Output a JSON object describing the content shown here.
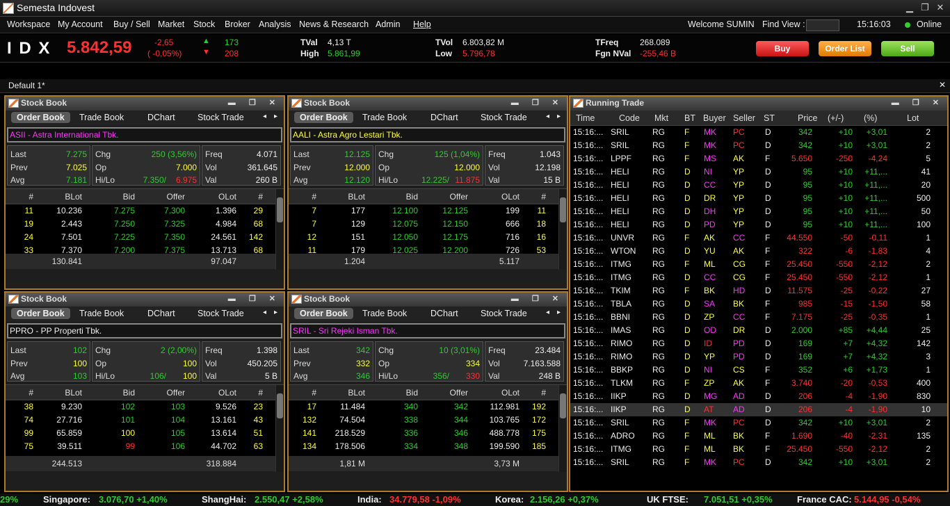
{
  "app": {
    "title": "Semesta Indovest"
  },
  "menu": {
    "items": [
      "Workspace",
      "My Account",
      "Buy / Sell",
      "Market",
      "Stock",
      "Broker",
      "Analysis",
      "News & Research",
      "Admin",
      "Help"
    ],
    "welcome": "Welcome SUMIN",
    "find_label": "Find View :",
    "time": "15:16:03",
    "status": "Online"
  },
  "index": {
    "name": "I D X",
    "value": "5.842,59",
    "chg": "-2,65",
    "chg_pct": "( -0,05%)",
    "up": "173",
    "down": "208",
    "tval_label": "TVal",
    "tval": "4,13 T",
    "high_label": "High",
    "high": "5.861,99",
    "tvol_label": "TVol",
    "tvol": "6.803,82 M",
    "low_label": "Low",
    "low": "5.796,78",
    "tfreq_label": "TFreq",
    "tfreq": "268.089",
    "fgn_label": "Fgn NVal",
    "fgn": "-255,46 B"
  },
  "buttons": {
    "buy": "Buy",
    "orderlist": "Order List",
    "sell": "Sell"
  },
  "workspace_tab": "Default 1*",
  "panels": [
    {
      "title": "Stock Book",
      "tabs": [
        "Order Book",
        "Trade Book",
        "DChart",
        "Stock Trade"
      ],
      "stock": "ASII - Astra International Tbk.",
      "stock_color": "m",
      "last": "7.275",
      "prev": "7.025",
      "avg": "7.181",
      "chg": "250 (3,56%)",
      "op": "7.000",
      "hi": "7.350/",
      "lo": "6.975",
      "freq": "4.071",
      "vol": "361.645",
      "val": "260 B",
      "rows": [
        [
          "11",
          "10.236",
          "7.275",
          "7.300",
          "1.396",
          "29"
        ],
        [
          "19",
          "2.443",
          "7.250",
          "7.325",
          "4.984",
          "68"
        ],
        [
          "24",
          "7.501",
          "7.225",
          "7.350",
          "24.561",
          "142"
        ],
        [
          "33",
          "7.370",
          "7.200",
          "7.375",
          "13.713",
          "68"
        ]
      ],
      "cols": [
        "#",
        "BLot",
        "Bid",
        "Offer",
        "OLot",
        "#"
      ],
      "foot_bid": "130.841",
      "foot_offer": "97.047"
    },
    {
      "title": "Stock Book",
      "tabs": [
        "Order Book",
        "Trade Book",
        "DChart",
        "Stock Trade"
      ],
      "stock": "AALI - Astra Agro Lestari Tbk.",
      "stock_color": "y",
      "last": "12.125",
      "prev": "12.000",
      "avg": "12.120",
      "chg": "125 (1,04%)",
      "op": "12.000",
      "hi": "12.225/",
      "lo": "11.875",
      "freq": "1.043",
      "vol": "12.198",
      "val": "15 B",
      "rows": [
        [
          "7",
          "177",
          "12.100",
          "12.125",
          "199",
          "11"
        ],
        [
          "7",
          "129",
          "12.075",
          "12.150",
          "666",
          "18"
        ],
        [
          "12",
          "151",
          "12.050",
          "12.175",
          "716",
          "16"
        ],
        [
          "11",
          "179",
          "12.025",
          "12.200",
          "726",
          "53"
        ]
      ],
      "cols": [
        "#",
        "BLot",
        "Bid",
        "Offer",
        "OLot",
        "#"
      ],
      "foot_bid": "1.204",
      "foot_offer": "5.117"
    },
    {
      "title": "Stock Book",
      "tabs": [
        "Order Book",
        "Trade Book",
        "DChart",
        "Stock Trade"
      ],
      "stock": "PPRO - PP Properti Tbk.",
      "stock_color": "w",
      "last": "102",
      "prev": "100",
      "avg": "103",
      "chg": "2 (2,00%)",
      "op": "100",
      "hi": "106/",
      "lo": "100",
      "freq": "1.398",
      "vol": "450.205",
      "val": "5 B",
      "rows": [
        [
          "38",
          "9.230",
          "102",
          "103",
          "9.526",
          "23"
        ],
        [
          "74",
          "27.716",
          "101",
          "104",
          "13.161",
          "43"
        ],
        [
          "99",
          "65.859",
          "100",
          "105",
          "13.614",
          "51"
        ],
        [
          "75",
          "39.511",
          "99",
          "106",
          "44.702",
          "63"
        ]
      ],
      "cols": [
        "#",
        "BLot",
        "Bid",
        "Offer",
        "OLot",
        "#"
      ],
      "foot_bid": "244.513",
      "foot_offer": "318.884"
    },
    {
      "title": "Stock Book",
      "tabs": [
        "Order Book",
        "Trade Book",
        "DChart",
        "Stock Trade"
      ],
      "stock": "SRIL - Sri Rejeki Isman Tbk.",
      "stock_color": "m",
      "last": "342",
      "prev": "332",
      "avg": "346",
      "chg": "10 (3,01%)",
      "op": "334",
      "hi": "356/",
      "lo": "330",
      "freq": "23.484",
      "vol": "7.163.588",
      "val": "248 B",
      "rows": [
        [
          "17",
          "11.484",
          "340",
          "342",
          "112.981",
          "192"
        ],
        [
          "132",
          "74.504",
          "338",
          "344",
          "103.765",
          "172"
        ],
        [
          "141",
          "218.529",
          "336",
          "346",
          "488.778",
          "175"
        ],
        [
          "134",
          "178.506",
          "334",
          "348",
          "199.590",
          "185"
        ]
      ],
      "cols": [
        "#",
        "BLot",
        "Bid",
        "Offer",
        "OLot",
        "#"
      ],
      "foot_bid": "1,81 M",
      "foot_offer": "3,73 M"
    }
  ],
  "running_trade": {
    "title": "Running Trade",
    "cols": [
      "Time",
      "Code",
      "Mkt",
      "BT",
      "Buyer",
      "Seller",
      "ST",
      "Price",
      "(+/-)",
      "(%)",
      "Lot"
    ],
    "rows": [
      [
        "15:16:...",
        "SRIL",
        "RG",
        "F",
        "MK",
        "PC",
        "D",
        "342",
        "+10",
        "+3,01",
        "2"
      ],
      [
        "15:16:...",
        "SRIL",
        "RG",
        "F",
        "MK",
        "PC",
        "D",
        "342",
        "+10",
        "+3,01",
        "2"
      ],
      [
        "15:16:...",
        "LPPF",
        "RG",
        "F",
        "MS",
        "AK",
        "F",
        "5.650",
        "-250",
        "-4,24",
        "5"
      ],
      [
        "15:16:...",
        "HELI",
        "RG",
        "D",
        "NI",
        "YP",
        "D",
        "95",
        "+10",
        "+11,...",
        "41"
      ],
      [
        "15:16:...",
        "HELI",
        "RG",
        "D",
        "CC",
        "YP",
        "D",
        "95",
        "+10",
        "+11,...",
        "20"
      ],
      [
        "15:16:...",
        "HELI",
        "RG",
        "D",
        "DR",
        "YP",
        "D",
        "95",
        "+10",
        "+11,...",
        "500"
      ],
      [
        "15:16:...",
        "HELI",
        "RG",
        "D",
        "DH",
        "YP",
        "D",
        "95",
        "+10",
        "+11,...",
        "50"
      ],
      [
        "15:16:...",
        "HELI",
        "RG",
        "D",
        "PD",
        "YP",
        "D",
        "95",
        "+10",
        "+11,...",
        "100"
      ],
      [
        "15:16:...",
        "UNVR",
        "RG",
        "F",
        "AK",
        "CC",
        "F",
        "44.550",
        "-50",
        "-0,11",
        "1"
      ],
      [
        "15:16:...",
        "WTON",
        "RG",
        "D",
        "YU",
        "AK",
        "F",
        "322",
        "-6",
        "-1,83",
        "4"
      ],
      [
        "15:16:...",
        "ITMG",
        "RG",
        "F",
        "ML",
        "CG",
        "F",
        "25.450",
        "-550",
        "-2,12",
        "2"
      ],
      [
        "15:16:...",
        "ITMG",
        "RG",
        "D",
        "CC",
        "CG",
        "F",
        "25.450",
        "-550",
        "-2,12",
        "1"
      ],
      [
        "15:16:...",
        "TKIM",
        "RG",
        "F",
        "BK",
        "HD",
        "D",
        "11.575",
        "-25",
        "-0,22",
        "27"
      ],
      [
        "15:16:...",
        "TBLA",
        "RG",
        "D",
        "SA",
        "BK",
        "F",
        "985",
        "-15",
        "-1,50",
        "58"
      ],
      [
        "15:16:...",
        "BBNI",
        "RG",
        "D",
        "ZP",
        "CC",
        "F",
        "7.175",
        "-25",
        "-0,35",
        "1"
      ],
      [
        "15:16:...",
        "IMAS",
        "RG",
        "D",
        "OD",
        "DR",
        "D",
        "2.000",
        "+85",
        "+4,44",
        "25"
      ],
      [
        "15:16:...",
        "RIMO",
        "RG",
        "D",
        "ID",
        "PD",
        "D",
        "169",
        "+7",
        "+4,32",
        "142"
      ],
      [
        "15:16:...",
        "RIMO",
        "RG",
        "D",
        "YP",
        "PD",
        "D",
        "169",
        "+7",
        "+4,32",
        "3"
      ],
      [
        "15:16:...",
        "BBKP",
        "RG",
        "D",
        "NI",
        "CS",
        "F",
        "352",
        "+6",
        "+1,73",
        "1"
      ],
      [
        "15:16:...",
        "TLKM",
        "RG",
        "F",
        "ZP",
        "AK",
        "F",
        "3.740",
        "-20",
        "-0,53",
        "400"
      ],
      [
        "15:16:...",
        "IIKP",
        "RG",
        "D",
        "MG",
        "AD",
        "D",
        "206",
        "-4",
        "-1,90",
        "830"
      ],
      [
        "15:16:...",
        "IIKP",
        "RG",
        "D",
        "AT",
        "AD",
        "D",
        "206",
        "-4",
        "-1,90",
        "10"
      ],
      [
        "15:16:...",
        "SRIL",
        "RG",
        "F",
        "MK",
        "PC",
        "D",
        "342",
        "+10",
        "+3,01",
        "2"
      ],
      [
        "15:16:...",
        "ADRO",
        "RG",
        "F",
        "ML",
        "BK",
        "F",
        "1.690",
        "-40",
        "-2,31",
        "135"
      ],
      [
        "15:16:...",
        "ITMG",
        "RG",
        "F",
        "ML",
        "BK",
        "F",
        "25.450",
        "-550",
        "-2,12",
        "2"
      ],
      [
        "15:16:...",
        "SRIL",
        "RG",
        "F",
        "MK",
        "PC",
        "D",
        "342",
        "+10",
        "+3,01",
        "2"
      ]
    ]
  },
  "ticker": [
    {
      "label": "",
      "value": "29%",
      "c": "g"
    },
    {
      "label": "Singapore:",
      "value": "3.076,70 +1,40%",
      "c": "g"
    },
    {
      "label": "ShangHai:",
      "value": "2.550,47 +2,58%",
      "c": "g"
    },
    {
      "label": "India:",
      "value": "34.779,58 -1,09%",
      "c": "r"
    },
    {
      "label": "Korea:",
      "value": "2.156,26 +0,37%",
      "c": "g"
    },
    {
      "label": "UK FTSE:",
      "value": "7.051,51 +0,35%",
      "c": "g"
    },
    {
      "label": "France CAC:",
      "value": "5.144,95 -0,54%",
      "c": "r"
    }
  ],
  "colors": {
    "panel_border": "#b07a2b",
    "up": "#2ecc2e",
    "down": "#ff3030",
    "unchanged": "#ffff33",
    "foreign": "#ff33ff"
  }
}
